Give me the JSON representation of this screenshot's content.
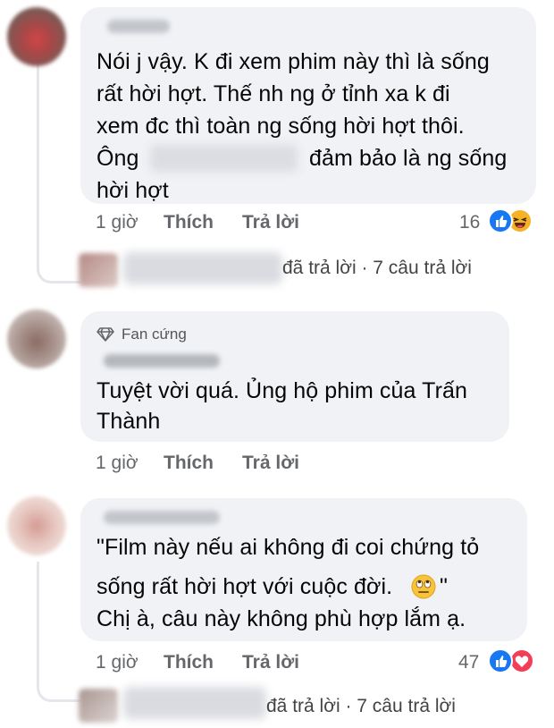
{
  "comments": [
    {
      "text_lines": [
        "Nói j vậy. K đi xem phim này thì là sống",
        "rất hời hợt. Thế nh ng ở tỉnh xa k đi",
        "xem đc thì toàn ng sống hời hợt thôi.",
        "Ông",
        "đảm bảo là ng sống",
        "hời hợt"
      ],
      "time": "1 giờ",
      "like": "Thích",
      "reply": "Trả lời",
      "reaction_count": "16",
      "reactions": [
        "like-icon",
        "haha-icon"
      ],
      "reply_summary": "đã trả lời · 7 câu trả lời"
    },
    {
      "badge": "Fan cứng",
      "badge_icon": "diamond-icon",
      "text_lines": [
        "Tuyệt vời quá. Ủng hộ phim của Trấn",
        "Thành"
      ],
      "time": "1 giờ",
      "like": "Thích",
      "reply": "Trả lời"
    },
    {
      "text_lines": [
        "\"Film này nếu ai không đi coi chứng tỏ",
        "sống rất hời hợt với cuộc đời.",
        "\"",
        "Chị à, câu này không phù hợp lắm ạ."
      ],
      "inline_emoji": "eye-roll-emoji",
      "time": "1 giờ",
      "like": "Thích",
      "reply": "Trả lời",
      "reaction_count": "47",
      "reactions": [
        "like-icon",
        "love-icon"
      ],
      "reply_summary": "đã trả lời · 7 câu trả lời"
    }
  ],
  "colors": {
    "bubble": "#f0f2f5",
    "meta_text": "#65676b",
    "like_blue": "#1877f2",
    "love_red": "#f33e58",
    "haha_yellow": "#f7b125"
  }
}
